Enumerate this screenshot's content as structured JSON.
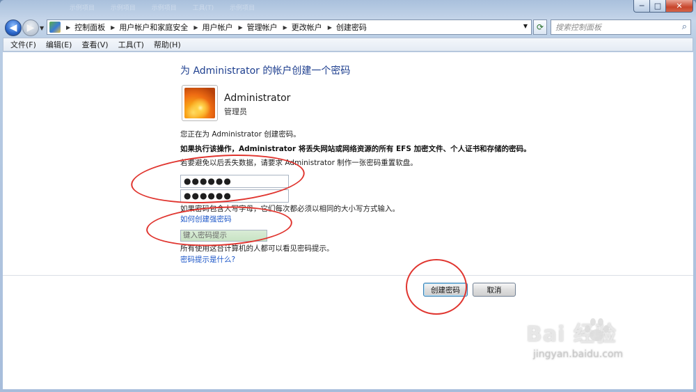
{
  "window": {
    "controls": {
      "minimize": "─",
      "maximize": "□",
      "close": "✕"
    },
    "taskbar_ghost": [
      "示例项目",
      "示例项目",
      "示例项目",
      "工具(T)",
      "示例项目"
    ]
  },
  "navigation": {
    "back_icon": "back-arrow-icon",
    "forward_icon": "forward-arrow-icon",
    "breadcrumbs": [
      "控制面板",
      "用户帐户和家庭安全",
      "用户帐户",
      "管理帐户",
      "更改帐户",
      "创建密码"
    ],
    "search_placeholder": "搜索控制面板"
  },
  "menu": [
    "文件(F)",
    "编辑(E)",
    "查看(V)",
    "工具(T)",
    "帮助(H)"
  ],
  "main": {
    "heading": "为 Administrator 的帐户创建一个密码",
    "user_name": "Administrator",
    "user_role": "管理员",
    "info_line1": "您正在为 Administrator 创建密码。",
    "warning": "如果执行该操作，Administrator 将丢失网站或网络资源的所有 EFS 加密文件、个人证书和存储的密码。",
    "info_line2": "若要避免以后丢失数据，请要求 Administrator 制作一张密码重置软盘。",
    "new_password": "●●●●●●",
    "confirm_password": "●●●●●●",
    "case_note": "如果密码包含大写字母，它们每次都必须以相同的大小写方式输入。",
    "strong_password_link": "如何创建强密码",
    "hint_placeholder": "键入密码提示",
    "hint_note": "所有使用这台计算机的人都可以看见密码提示。",
    "hint_link": "密码提示是什么?",
    "create_button": "创建密码",
    "cancel_button": "取消"
  },
  "watermark": {
    "brand": "Bai  经验",
    "url": "jingyan.baidu.com"
  },
  "colors": {
    "link": "#1c56c8",
    "heading": "#1e3f8f",
    "annotation": "#e0352f"
  }
}
